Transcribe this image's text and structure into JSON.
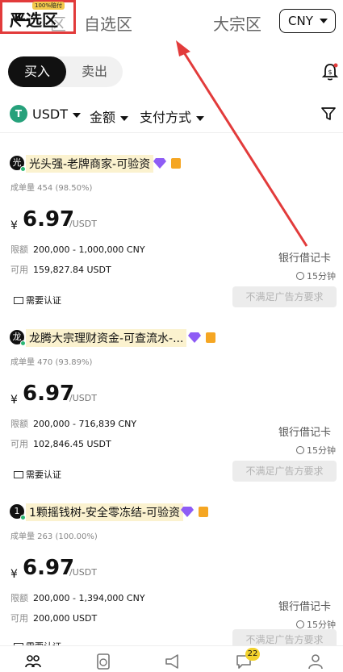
{
  "header": {
    "tabs": [
      {
        "label": "区"
      },
      {
        "label": "自选区"
      },
      {
        "label": "严选区",
        "badge": "100%赔付"
      },
      {
        "label": "大宗区"
      }
    ],
    "currency": "CNY"
  },
  "trade_toggle": {
    "buy": "买入",
    "sell": "卖出"
  },
  "filters": {
    "asset": "USDT",
    "amount": "金额",
    "payment": "支付方式"
  },
  "merchants": [
    {
      "avatar": "光",
      "name": "光头强-老牌商家-可验资",
      "stats": "成单量 454 (98.50%)",
      "currency_symbol": "¥",
      "price": "6.97",
      "unit": "/USDT",
      "limit_label": "限额",
      "limit": "200,000 - 1,000,000 CNY",
      "avail_label": "可用",
      "available": "159,827.84 USDT",
      "payment": "银行借记卡",
      "time": "15分钟",
      "verify": "需要认证",
      "action": "不满足广告方要求"
    },
    {
      "avatar": "龙",
      "name": "龙腾大宗理财资金-可查流水-...",
      "stats": "成单量 470 (93.89%)",
      "currency_symbol": "¥",
      "price": "6.97",
      "unit": "/USDT",
      "limit_label": "限额",
      "limit": "200,000 - 716,839 CNY",
      "avail_label": "可用",
      "available": "102,846.45 USDT",
      "payment": "银行借记卡",
      "time": "15分钟",
      "verify": "需要认证",
      "action": "不满足广告方要求"
    },
    {
      "avatar": "1",
      "name": "1颗摇钱树-安全零冻结-可验资",
      "stats": "成单量 263 (100.00%)",
      "currency_symbol": "¥",
      "price": "6.97",
      "unit": "/USDT",
      "limit_label": "限额",
      "limit": "200,000 - 1,394,000 CNY",
      "avail_label": "可用",
      "available": "200,000 USDT",
      "payment": "银行借记卡",
      "time": "15分钟",
      "verify": "需要认证",
      "action": "不满足广告方要求"
    }
  ],
  "bottom_nav": {
    "messages_badge": "22"
  },
  "icons": {
    "back": "back-arrow-icon",
    "bell": "bell-icon",
    "filter": "filter-funnel-icon",
    "nav": [
      "p2p-users-icon",
      "orders-icon",
      "megaphone-icon",
      "chat-icon",
      "profile-icon"
    ]
  },
  "colors": {
    "accent_red": "#e23b3b",
    "badge_yellow": "#f2c94c",
    "online_green": "#2bb673",
    "usdt_green": "#26a17b",
    "diamond_purple": "#8e5cf5"
  }
}
